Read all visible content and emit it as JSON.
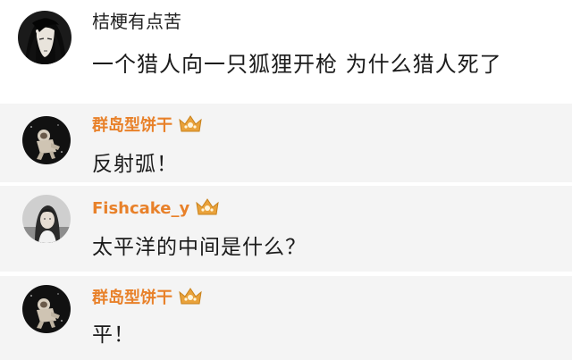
{
  "post": {
    "username": "桔梗有点苦",
    "text": "一个猎人向一只狐狸开枪  为什么猎人死了",
    "avatar_icon": "anime-girl-avatar"
  },
  "replies": [
    {
      "username": "群岛型饼干",
      "text": "反射弧！",
      "avatar_icon": "astronaut-avatar",
      "badge_icon": "crown-badge-icon"
    },
    {
      "username": "Fishcake_y",
      "text": "太平洋的中间是什么？",
      "avatar_icon": "girl-photo-avatar",
      "badge_icon": "crown-badge-icon"
    },
    {
      "username": "群岛型饼干",
      "text": "平！",
      "avatar_icon": "astronaut-avatar",
      "badge_icon": "crown-badge-icon"
    }
  ],
  "colors": {
    "username_accent": "#e8812a",
    "reply_background": "#f4f4f4",
    "badge_gold": "#e9a23b"
  }
}
